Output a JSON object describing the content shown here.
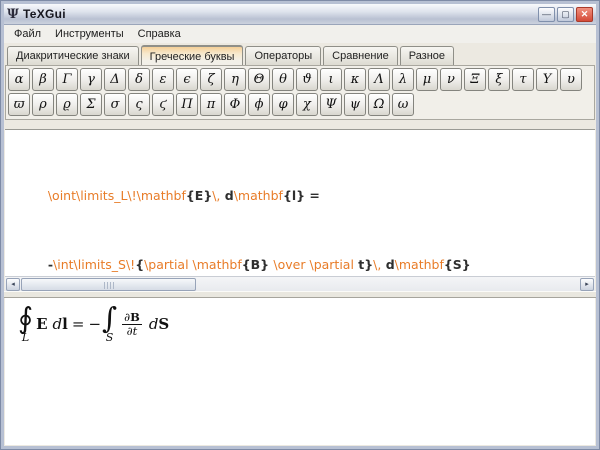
{
  "window": {
    "title": "TeXGui",
    "icon": "Ψ",
    "controls": {
      "minimize": "—",
      "maximize": "▢",
      "close": "✕"
    }
  },
  "menu": {
    "items": [
      "Файл",
      "Инструменты",
      "Справка"
    ]
  },
  "tabs": [
    {
      "label": "Диакритические знаки",
      "selected": false
    },
    {
      "label": "Греческие буквы",
      "selected": true
    },
    {
      "label": "Операторы",
      "selected": false
    },
    {
      "label": "Сравнение",
      "selected": false
    },
    {
      "label": "Разное",
      "selected": false
    }
  ],
  "palette": {
    "row1": [
      "α",
      "β",
      "Γ",
      "γ",
      "Δ",
      "δ",
      "ε",
      "ϵ",
      "ζ",
      "η",
      "Θ",
      "θ",
      "ϑ",
      "ι",
      "κ",
      "Λ",
      "λ",
      "μ",
      "ν",
      "Ξ",
      "ξ",
      "τ",
      "Υ",
      "υ"
    ],
    "row2": [
      "ϖ",
      "ρ",
      "ϱ",
      "Σ",
      "σ",
      "ς",
      "ϛ",
      "Π",
      "π",
      "Φ",
      "ϕ",
      "φ",
      "χ",
      "Ψ",
      "ψ",
      "Ω",
      "ω"
    ]
  },
  "editor": {
    "line1_tokens": [
      {
        "c": "cmd",
        "t": "\\oint\\limits_L\\!\\mathbf"
      },
      {
        "c": "lit",
        "t": "{E}"
      },
      {
        "c": "cmd",
        "t": "\\,"
      },
      {
        "c": "lit",
        "t": " d"
      },
      {
        "c": "cmd",
        "t": "\\mathbf"
      },
      {
        "c": "lit",
        "t": "{l} ="
      }
    ],
    "line2_tokens": [
      {
        "c": "lit",
        "t": "-"
      },
      {
        "c": "cmd",
        "t": "\\int\\limits_S\\!"
      },
      {
        "c": "lit",
        "t": "{"
      },
      {
        "c": "cmd",
        "t": "\\partial \\mathbf"
      },
      {
        "c": "lit",
        "t": "{B} "
      },
      {
        "c": "cmd",
        "t": "\\over \\partial"
      },
      {
        "c": "lit",
        "t": " t}"
      },
      {
        "c": "cmd",
        "t": "\\,"
      },
      {
        "c": "lit",
        "t": " d"
      },
      {
        "c": "cmd",
        "t": "\\mathbf"
      },
      {
        "c": "lit",
        "t": "{S}"
      }
    ]
  },
  "scrollbar": {
    "left_arrow": "◂",
    "right_arrow": "▸"
  },
  "preview": {
    "formula": {
      "lhs_integral": "∮",
      "lhs_limit": "L",
      "vec_E": "E",
      "diff1": "d",
      "var_l": "l",
      "equals": "=",
      "minus": "−",
      "rhs_integral": "∫",
      "rhs_limit": "S",
      "num_partial": "∂",
      "num_var": "B",
      "den_partial": "∂",
      "den_var": "t",
      "diff2": "d",
      "var_S": "S"
    }
  },
  "colors": {
    "command_text": "#e87c28",
    "literal_text": "#2f2f2f",
    "tab_accent": "#e89c3c",
    "close_button": "#d44a38"
  }
}
